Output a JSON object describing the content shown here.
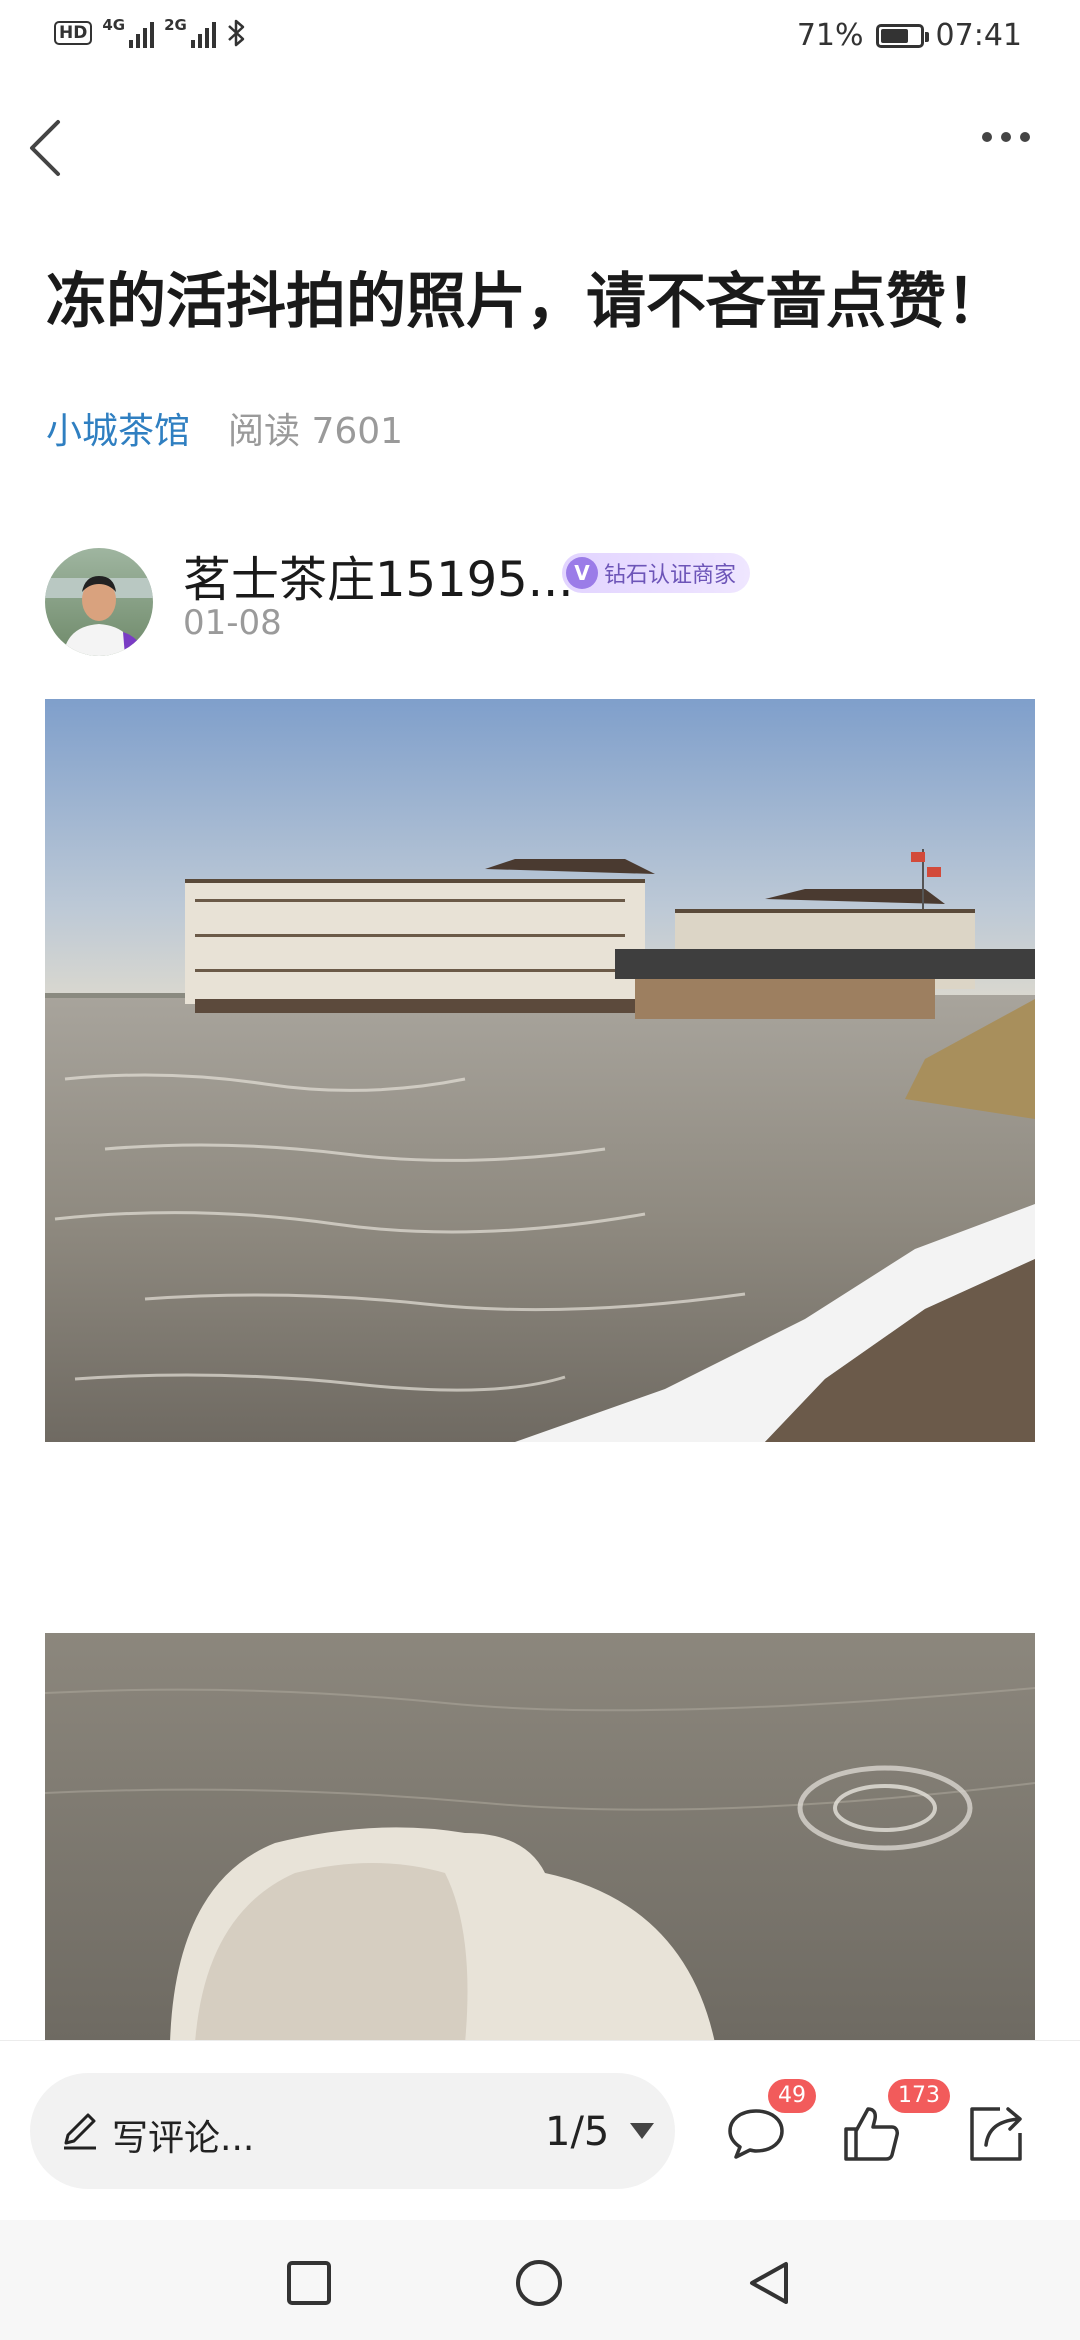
{
  "status_bar": {
    "hd_label": "HD",
    "network_1": "4G",
    "network_2": "2G",
    "battery_percent": "71%",
    "battery_level": 0.71,
    "time": "07:41",
    "icons": [
      "hd-icon",
      "signal-icon",
      "bluetooth-icon",
      "battery-icon"
    ]
  },
  "nav": {
    "back_icon": "chevron-left-icon",
    "more_icon": "more-dots-icon"
  },
  "article": {
    "title": "冻的活抖拍的照片，请不吝啬点赞！",
    "circle": "小城茶馆",
    "reads": "阅读 7601"
  },
  "author": {
    "name": "茗士茶庄15195...",
    "badge_v": "V",
    "badge_label": "钻石认证商家",
    "date": "01-08"
  },
  "action_bar": {
    "comment_placeholder": "写评论...",
    "page_indicator": "1/5",
    "comment_count": "49",
    "like_count": "173",
    "icons": [
      "pen-icon",
      "caret-down-icon",
      "comment-icon",
      "thumbs-up-icon",
      "share-icon"
    ]
  },
  "system_nav": {
    "icons": [
      "recent-apps-icon",
      "home-icon",
      "back-triangle-icon"
    ]
  },
  "colors": {
    "link_blue": "#2f7fc1",
    "badge_red": "#f25b5b",
    "badge_purple": "#9b7ce8"
  }
}
